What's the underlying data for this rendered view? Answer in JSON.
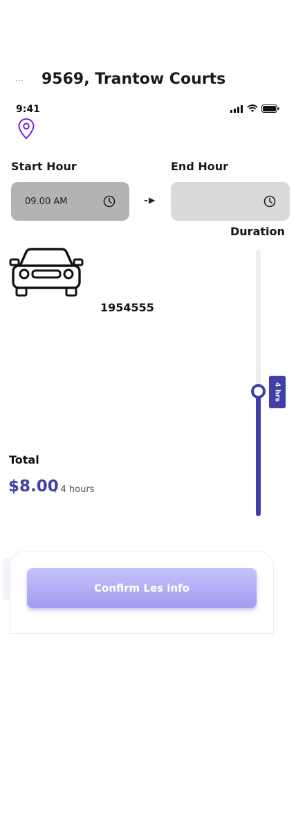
{
  "header": {
    "back_glyph": "···",
    "title": "9569, Trantow Courts"
  },
  "status_bar": {
    "time": "9:41",
    "icons": [
      "signal-icon",
      "wifi-icon",
      "battery-icon"
    ]
  },
  "location_icon": "map-pin-icon",
  "start_hour": {
    "label": "Start Hour",
    "value": "09.00 AM",
    "icon": "clock-icon"
  },
  "end_hour": {
    "label": "End Hour",
    "value": "",
    "icon": "clock-icon"
  },
  "duration": {
    "label": "Duration",
    "value_label": "4 hrs",
    "fraction": 0.47
  },
  "vehicle": {
    "icon": "car-icon",
    "plate": "1954555"
  },
  "total": {
    "label": "Total",
    "amount": "$8.00",
    "per": "/ 4 hours"
  },
  "confirm": {
    "label": "Confirm Les info"
  },
  "colors": {
    "accent": "#3f3fa6",
    "pin": "#7d1fd6",
    "button_top": "#c7c3fb",
    "button_bottom": "#a09cef",
    "field_start": "#b3b3b3",
    "field_end": "#d9d9d9"
  }
}
